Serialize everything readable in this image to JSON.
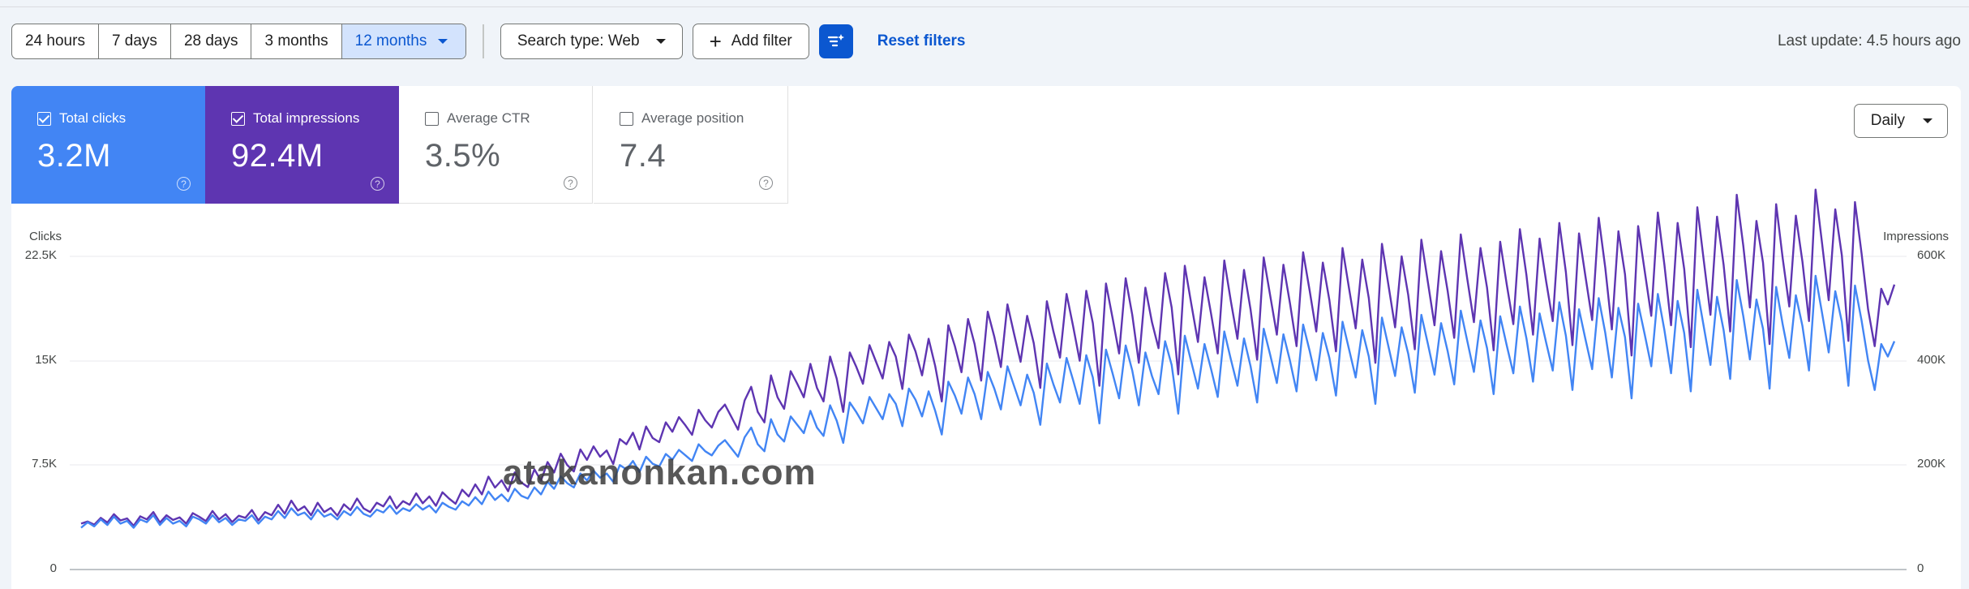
{
  "toolbar": {
    "ranges": [
      "24 hours",
      "7 days",
      "28 days",
      "3 months",
      "12 months"
    ],
    "active_range": "12 months",
    "search_type": "Search type: Web",
    "add_filter": "Add filter",
    "reset_filters": "Reset filters",
    "last_update": "Last update: 4.5 hours ago"
  },
  "metrics": {
    "clicks": {
      "label": "Total clicks",
      "value": "3.2M",
      "checked": true
    },
    "impressions": {
      "label": "Total impressions",
      "value": "92.4M",
      "checked": true
    },
    "ctr": {
      "label": "Average CTR",
      "value": "3.5%",
      "checked": false
    },
    "position": {
      "label": "Average position",
      "value": "7.4",
      "checked": false
    },
    "help_glyph": "?"
  },
  "granularity": "Daily",
  "watermark": "atakanonkan.com",
  "colors": {
    "clicks": "#4285f4",
    "impressions": "#5e35b1",
    "accent": "#0b57d0"
  },
  "chart_data": {
    "type": "line",
    "left_axis": {
      "title": "Clicks",
      "ticks": [
        "22.5K",
        "15K",
        "7.5K",
        "0"
      ],
      "range": [
        0,
        22500
      ]
    },
    "right_axis": {
      "title": "Impressions",
      "ticks": [
        "600K",
        "400K",
        "200K",
        "0"
      ],
      "range": [
        0,
        600000
      ]
    },
    "grid": true,
    "series": [
      {
        "name": "Clicks",
        "axis": "left",
        "values": [
          3000,
          3400,
          3100,
          3600,
          3200,
          3800,
          3300,
          3500,
          3000,
          3600,
          3400,
          3900,
          3200,
          3700,
          3300,
          3500,
          3100,
          3800,
          3600,
          3300,
          3900,
          3400,
          3700,
          3200,
          3600,
          3500,
          3900,
          3300,
          3800,
          3600,
          4200,
          3700,
          4400,
          3900,
          4100,
          3600,
          4300,
          3800,
          4000,
          3600,
          4200,
          3900,
          4500,
          4000,
          3800,
          4300,
          4100,
          4600,
          4000,
          4400,
          4200,
          4700,
          4300,
          4600,
          4100,
          4800,
          4500,
          4300,
          4900,
          4600,
          5200,
          4700,
          5600,
          5000,
          5400,
          4900,
          5800,
          5300,
          5100,
          5900,
          5400,
          6300,
          5800,
          6700,
          6200,
          5900,
          6900,
          6400,
          7100,
          6600,
          6900,
          6300,
          7500,
          7200,
          7800,
          7000,
          8100,
          7600,
          7400,
          8300,
          7900,
          8600,
          8200,
          7800,
          9000,
          8500,
          8200,
          8900,
          9300,
          8700,
          8100,
          9500,
          10200,
          9000,
          8500,
          10800,
          9700,
          9200,
          11000,
          10400,
          9800,
          11400,
          10200,
          9600,
          11800,
          10700,
          9100,
          12000,
          11300,
          10500,
          12400,
          11600,
          10800,
          12600,
          11900,
          10300,
          13000,
          12200,
          11000,
          12800,
          11400,
          9700,
          13500,
          12500,
          11200,
          13800,
          12600,
          10800,
          14200,
          13000,
          11500,
          14600,
          13200,
          11800,
          14000,
          12700,
          10400,
          14800,
          13300,
          12000,
          15200,
          13600,
          11900,
          15400,
          13800,
          10500,
          15800,
          14100,
          12300,
          16100,
          14300,
          11800,
          15600,
          13900,
          12600,
          16400,
          14700,
          11200,
          16800,
          14900,
          13000,
          16200,
          14400,
          12400,
          17100,
          15100,
          13200,
          16600,
          14600,
          12000,
          17300,
          15400,
          13400,
          16900,
          15000,
          12800,
          17600,
          15700,
          13600,
          17000,
          15200,
          12500,
          17800,
          15800,
          13800,
          17200,
          15300,
          11900,
          18100,
          16000,
          13900,
          17400,
          15500,
          12700,
          18300,
          16200,
          14000,
          17700,
          15700,
          13300,
          18600,
          16400,
          14200,
          17900,
          15900,
          12600,
          18200,
          16100,
          14100,
          18900,
          16600,
          13500,
          18400,
          16300,
          14300,
          19200,
          16800,
          12900,
          18700,
          16500,
          14400,
          19500,
          17000,
          13800,
          18800,
          16700,
          12300,
          19100,
          16900,
          14600,
          19800,
          17200,
          14100,
          19300,
          17000,
          12800,
          20100,
          17400,
          14700,
          19600,
          17200,
          13700,
          20800,
          18200,
          15100,
          19400,
          17300,
          13000,
          20300,
          17600,
          15200,
          19700,
          17500,
          14300,
          21100,
          18400,
          15600,
          20000,
          17800,
          13200,
          20400,
          17900,
          15000,
          12900,
          16200,
          15300,
          16400
        ]
      },
      {
        "name": "Impressions",
        "axis": "right",
        "values": [
          88000,
          92000,
          86000,
          99000,
          90000,
          106000,
          94000,
          98000,
          84000,
          102000,
          96000,
          110000,
          90000,
          104000,
          95000,
          100000,
          88000,
          108000,
          101000,
          93000,
          112000,
          96000,
          106000,
          91000,
          103000,
          99000,
          114000,
          94000,
          110000,
          104000,
          124000,
          107000,
          132000,
          113000,
          121000,
          104000,
          128000,
          110000,
          118000,
          103000,
          125000,
          114000,
          136000,
          117000,
          110000,
          128000,
          121000,
          140000,
          117000,
          131000,
          124000,
          146000,
          127000,
          140000,
          122000,
          148000,
          136000,
          126000,
          153000,
          140000,
          163000,
          144000,
          178000,
          157000,
          171000,
          150000,
          186000,
          167000,
          158000,
          192000,
          170000,
          206000,
          186000,
          222000,
          200000,
          188000,
          230000,
          210000,
          236000,
          216000,
          228000,
          202000,
          250000,
          240000,
          262000,
          230000,
          274000,
          252000,
          244000,
          282000,
          264000,
          292000,
          276000,
          258000,
          306000,
          286000,
          272000,
          302000,
          316000,
          292000,
          268000,
          324000,
          350000,
          302000,
          282000,
          372000,
          330000,
          308000,
          380000,
          356000,
          330000,
          394000,
          348000,
          322000,
          408000,
          366000,
          302000,
          416000,
          388000,
          356000,
          430000,
          398000,
          366000,
          436000,
          408000,
          346000,
          450000,
          418000,
          372000,
          442000,
          390000,
          322000,
          468000,
          428000,
          378000,
          480000,
          432000,
          362000,
          494000,
          446000,
          388000,
          508000,
          452000,
          398000,
          486000,
          434000,
          348000,
          514000,
          456000,
          406000,
          528000,
          466000,
          400000,
          534000,
          472000,
          352000,
          548000,
          482000,
          414000,
          558000,
          488000,
          396000,
          540000,
          474000,
          424000,
          568000,
          502000,
          374000,
          582000,
          508000,
          436000,
          560000,
          490000,
          414000,
          592000,
          514000,
          442000,
          574000,
          498000,
          402000,
          598000,
          524000,
          450000,
          584000,
          510000,
          428000,
          608000,
          534000,
          456000,
          588000,
          516000,
          418000,
          616000,
          538000,
          462000,
          594000,
          520000,
          396000,
          624000,
          544000,
          464000,
          600000,
          526000,
          422000,
          632000,
          550000,
          468000,
          610000,
          534000,
          444000,
          642000,
          556000,
          474000,
          616000,
          540000,
          420000,
          628000,
          546000,
          470000,
          652000,
          564000,
          450000,
          634000,
          552000,
          476000,
          664000,
          570000,
          430000,
          644000,
          560000,
          478000,
          674000,
          578000,
          460000,
          648000,
          566000,
          410000,
          658000,
          572000,
          486000,
          684000,
          584000,
          468000,
          664000,
          576000,
          426000,
          694000,
          590000,
          488000,
          676000,
          584000,
          456000,
          718000,
          620000,
          502000,
          668000,
          588000,
          432000,
          700000,
          596000,
          504000,
          678000,
          590000,
          476000,
          728000,
          624000,
          516000,
          690000,
          602000,
          438000,
          704000,
          606000,
          498000,
          428000,
          538000,
          508000,
          546000
        ]
      }
    ]
  }
}
